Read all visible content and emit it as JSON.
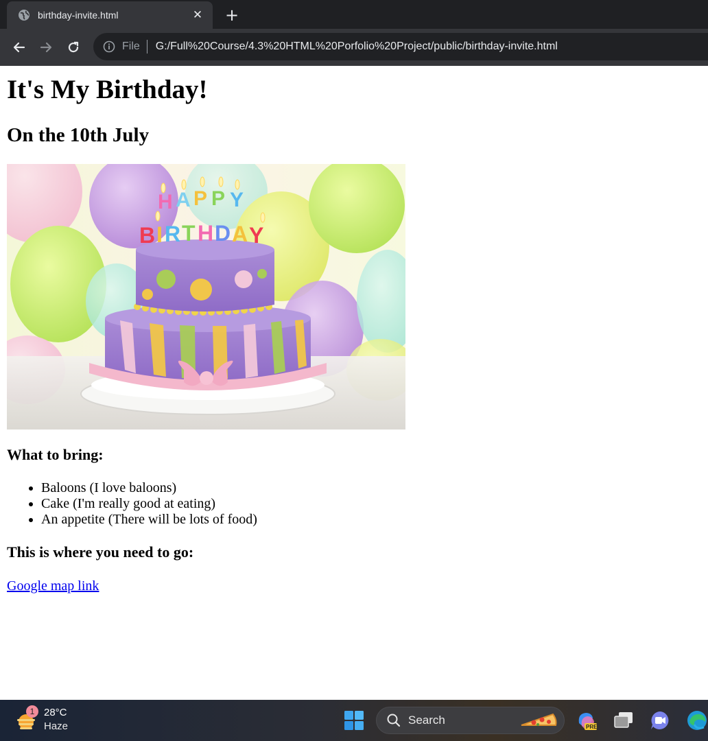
{
  "browser": {
    "tab_title": "birthday-invite.html",
    "new_tab_symbol": "+",
    "close_symbol": "✕",
    "scheme_label": "File",
    "url": "G:/Full%20Course/4.3%20HTML%20Porfolio%20Project/public/birthday-invite.html"
  },
  "page": {
    "heading": "It's My Birthday!",
    "date": "On the 10th July",
    "bring_heading": "What to bring:",
    "bring_items": [
      "Baloons (I love baloons)",
      "Cake (I'm really good at eating)",
      "An appetite (There will be lots of food)"
    ],
    "where_heading": "This is where you need to go:",
    "map_link": "Google map link",
    "cake_candles_text": [
      "HAPPY",
      "BIRTHDAY"
    ]
  },
  "taskbar": {
    "weather_temp": "28°C",
    "weather_condition": "Haze",
    "weather_badge": "1",
    "search_placeholder": "Search",
    "icons": [
      "windows-start-icon",
      "copilot-icon",
      "task-view-icon",
      "teams-meet-icon",
      "edge-icon"
    ]
  },
  "colors": {
    "chrome_dark": "#1f2023",
    "chrome_tab": "#35363a",
    "omnibox": "#202124",
    "link": "#0000ee"
  }
}
